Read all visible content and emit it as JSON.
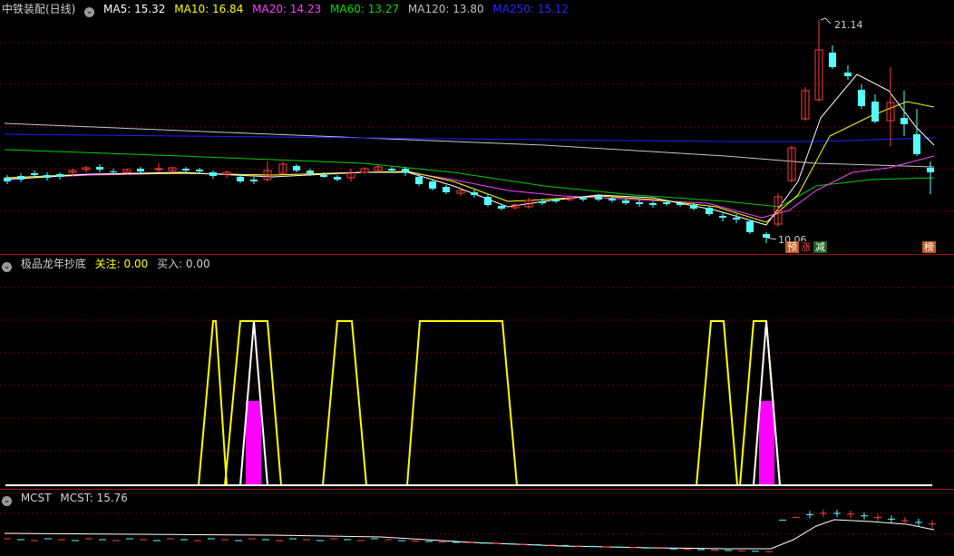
{
  "main": {
    "stock_title": "中铁装配(日线)",
    "ma": [
      {
        "label": "MA5: 15.32",
        "color": "#ffffff"
      },
      {
        "label": "MA10: 16.84",
        "color": "#ffff00"
      },
      {
        "label": "MA20: 14.23",
        "color": "#ff40ff"
      },
      {
        "label": "MA60: 13.27",
        "color": "#00e000"
      },
      {
        "label": "MA120: 13.80",
        "color": "#c0c0c0"
      },
      {
        "label": "MA250: 15.12",
        "color": "#2020ff"
      }
    ],
    "high_label": "21.14",
    "low_label": "10.06",
    "tags": [
      {
        "text": "预",
        "bg": "#c05a20",
        "color": "#ffffff"
      },
      {
        "text": "涨",
        "bg": "#000000",
        "color": "#ff4040"
      },
      {
        "text": "减",
        "bg": "#206020",
        "color": "#ffffff"
      },
      {
        "text": "榜",
        "bg": "#c05a20",
        "color": "#ffffff"
      }
    ]
  },
  "indicator": {
    "name": "极品龙年抄底",
    "focus_label": "关注: 0.00",
    "buy_label": "买入: 0.00"
  },
  "mcst": {
    "name": "MCST",
    "value_label": "MCST: 15.76"
  },
  "colors": {
    "up": "#ff3c3c",
    "down": "#54ffff",
    "grid": "#8b0000",
    "yellow_line": "#ffff00",
    "white_line": "#ffffff",
    "magenta_bar": "#ff00ff"
  }
}
